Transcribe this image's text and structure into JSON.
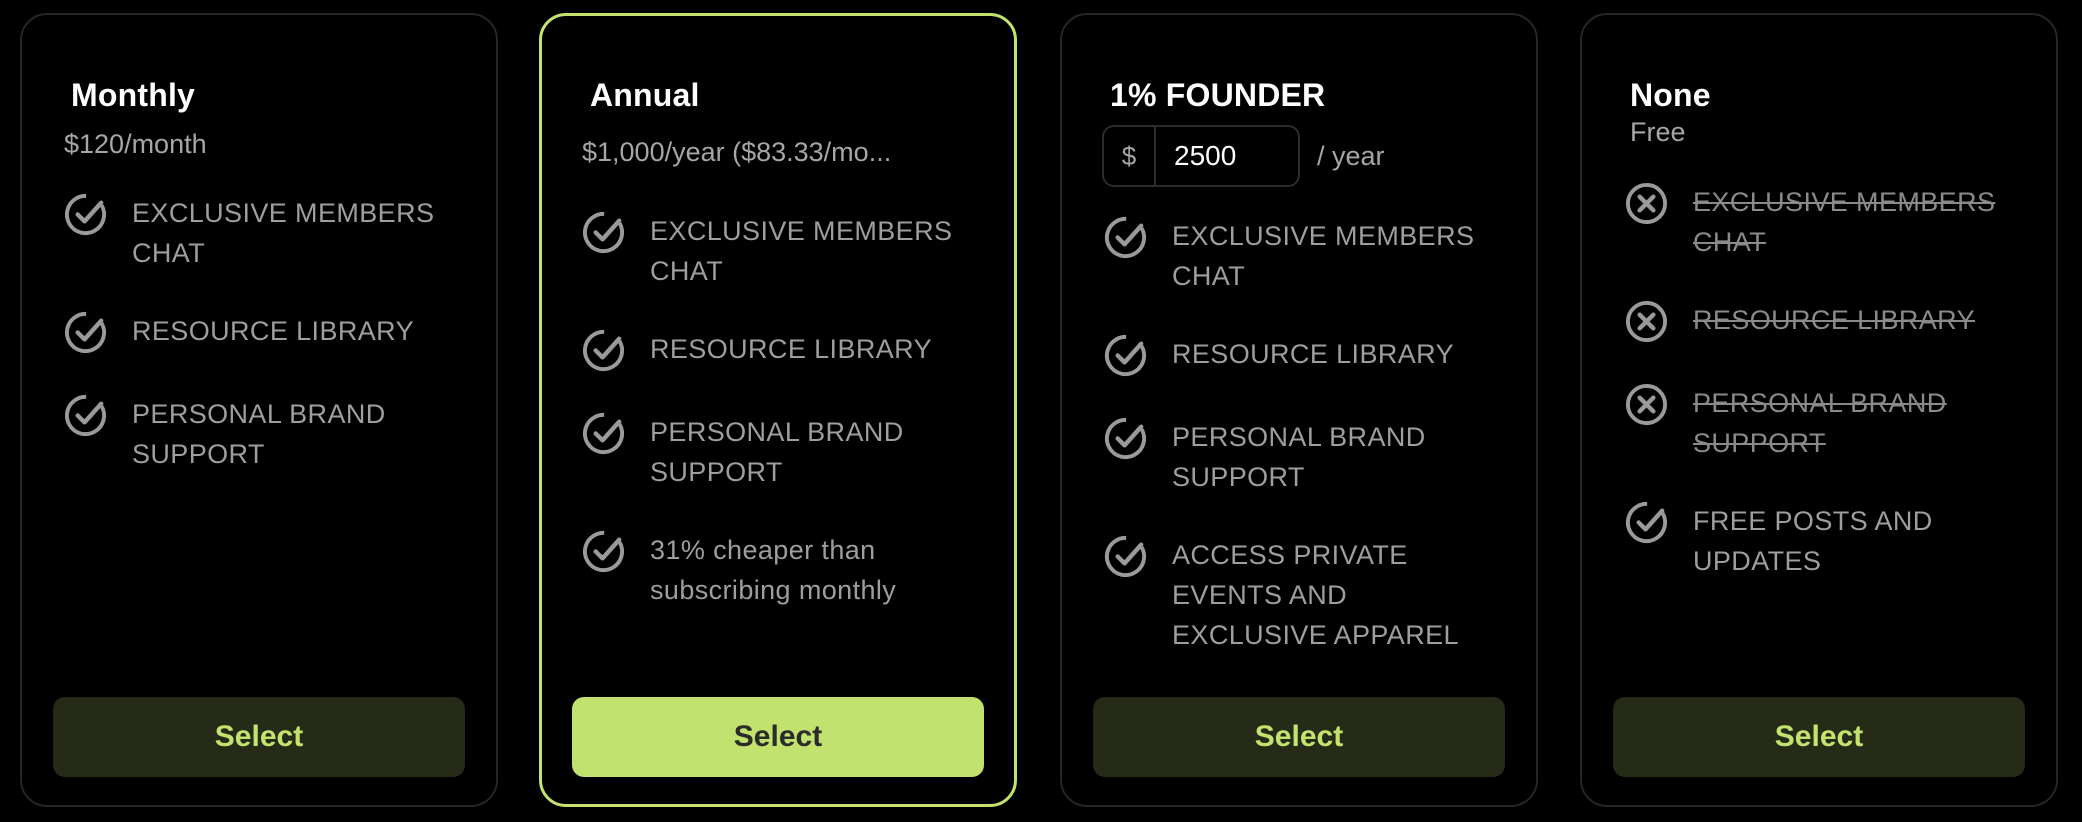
{
  "colors": {
    "background": "#000000",
    "card_border": "#262626",
    "accent": "#c3e36e",
    "button_dark": "#262b17",
    "text_muted": "#9e9e9e"
  },
  "plans": [
    {
      "title": "Monthly",
      "price": "$120/month",
      "features": [
        {
          "label": "EXCLUSIVE MEMBERS CHAT",
          "icon": "check-circle-icon",
          "included": true
        },
        {
          "label": "RESOURCE LIBRARY",
          "icon": "check-circle-icon",
          "included": true
        },
        {
          "label": "PERSONAL BRAND SUPPORT",
          "icon": "check-circle-icon",
          "included": true
        }
      ],
      "button_label": "Select",
      "selected": false
    },
    {
      "title": "Annual",
      "price": "$1,000/year ($83.33/mo...",
      "features": [
        {
          "label": "EXCLUSIVE MEMBERS CHAT",
          "icon": "check-circle-icon",
          "included": true
        },
        {
          "label": "RESOURCE LIBRARY",
          "icon": "check-circle-icon",
          "included": true
        },
        {
          "label": "PERSONAL BRAND SUPPORT",
          "icon": "check-circle-icon",
          "included": true
        },
        {
          "label": "31% cheaper than subscribing monthly",
          "icon": "check-circle-icon",
          "included": true
        }
      ],
      "button_label": "Select",
      "selected": true
    },
    {
      "title": "1% FOUNDER",
      "price_currency": "$",
      "price_value": "2500",
      "price_suffix": "/ year",
      "features": [
        {
          "label": "EXCLUSIVE MEMBERS CHAT",
          "icon": "check-circle-icon",
          "included": true
        },
        {
          "label": "RESOURCE LIBRARY",
          "icon": "check-circle-icon",
          "included": true
        },
        {
          "label": "PERSONAL BRAND SUPPORT",
          "icon": "check-circle-icon",
          "included": true
        },
        {
          "label": "ACCESS PRIVATE EVENTS AND EXCLUSIVE APPAREL",
          "icon": "check-circle-icon",
          "included": true
        }
      ],
      "button_label": "Select",
      "selected": false
    },
    {
      "title": "None",
      "price": "Free",
      "features": [
        {
          "label": "EXCLUSIVE MEMBERS CHAT",
          "icon": "x-circle-icon",
          "included": false
        },
        {
          "label": "RESOURCE LIBRARY",
          "icon": "x-circle-icon",
          "included": false
        },
        {
          "label": "PERSONAL BRAND SUPPORT",
          "icon": "x-circle-icon",
          "included": false
        },
        {
          "label": "FREE POSTS AND UPDATES",
          "icon": "check-circle-icon",
          "included": true
        }
      ],
      "button_label": "Select",
      "selected": false
    }
  ]
}
